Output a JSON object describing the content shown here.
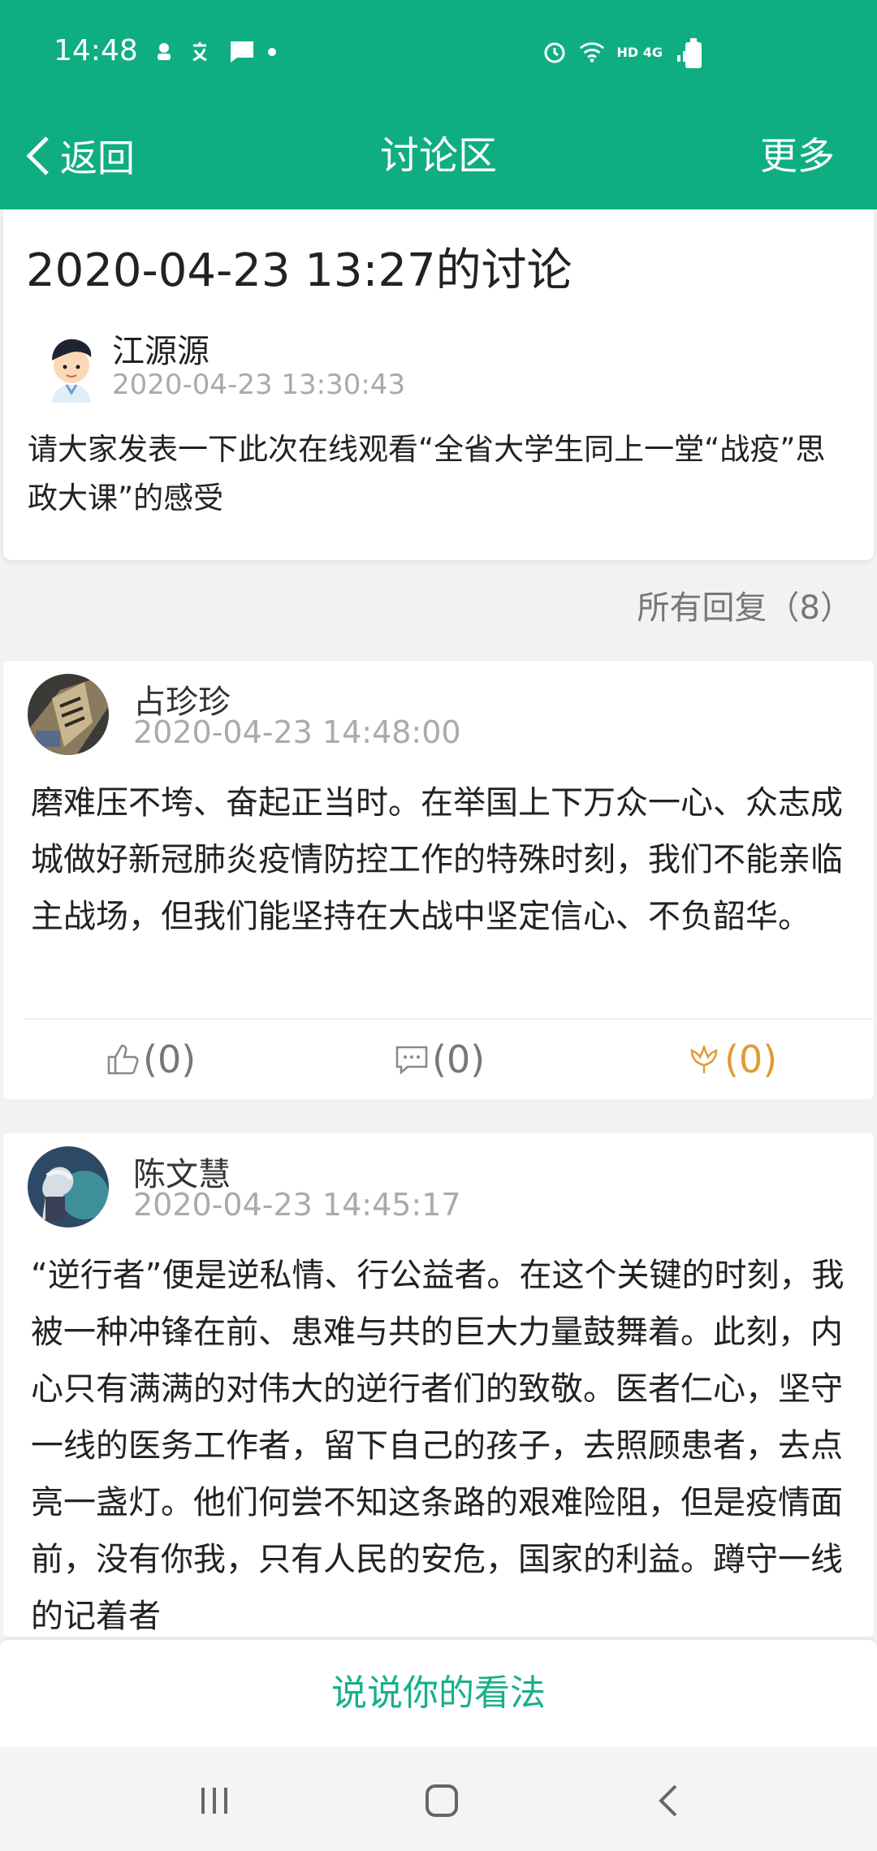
{
  "status_bar": {
    "time": "14:48",
    "network": "HD 4G"
  },
  "app_bar": {
    "back_label": "返回",
    "title": "讨论区",
    "more_label": "更多"
  },
  "topic": {
    "title": "2020-04-23 13:27的讨论",
    "author": "江源源",
    "time": "2020-04-23 13:30:43",
    "body": "请大家发表一下此次在线观看“全省大学生同上一堂“战疫”思政大课”的感受"
  },
  "replies_header": "所有回复（8）",
  "replies": [
    {
      "author": "占珍珍",
      "time": "2020-04-23 14:48:00",
      "body": "磨难压不垮、奋起正当时。在举国上下万众一心、众志成城做好新冠肺炎疫情防控工作的特殊时刻，我们不能亲临主战场，但我们能坚持在大战中坚定信心、不负韶华。",
      "likes": "(0)",
      "comments": "(0)",
      "flowers": "(0)"
    },
    {
      "author": "陈文慧",
      "time": "2020-04-23 14:45:17",
      "body": "“逆行者”便是逆私情、行公益者。在这个关键的时刻，我被一种冲锋在前、患难与共的巨大力量鼓舞着。此刻，内心只有满满的对伟大的逆行者们的致敬。医者仁心，坚守一线的医务工作者，留下自己的孩子，去照顾患者，去点亮一盏灯。他们何尝不知这条路的艰难险阻，但是疫情面前，没有你我，只有人民的安危，国家的利益。蹲守一线的记着者"
    }
  ],
  "comment_bar": {
    "label": "说说你的看法"
  },
  "colors": {
    "brand": "#0fae82",
    "accent_text": "#17b08a",
    "flower": "#e39a35"
  }
}
